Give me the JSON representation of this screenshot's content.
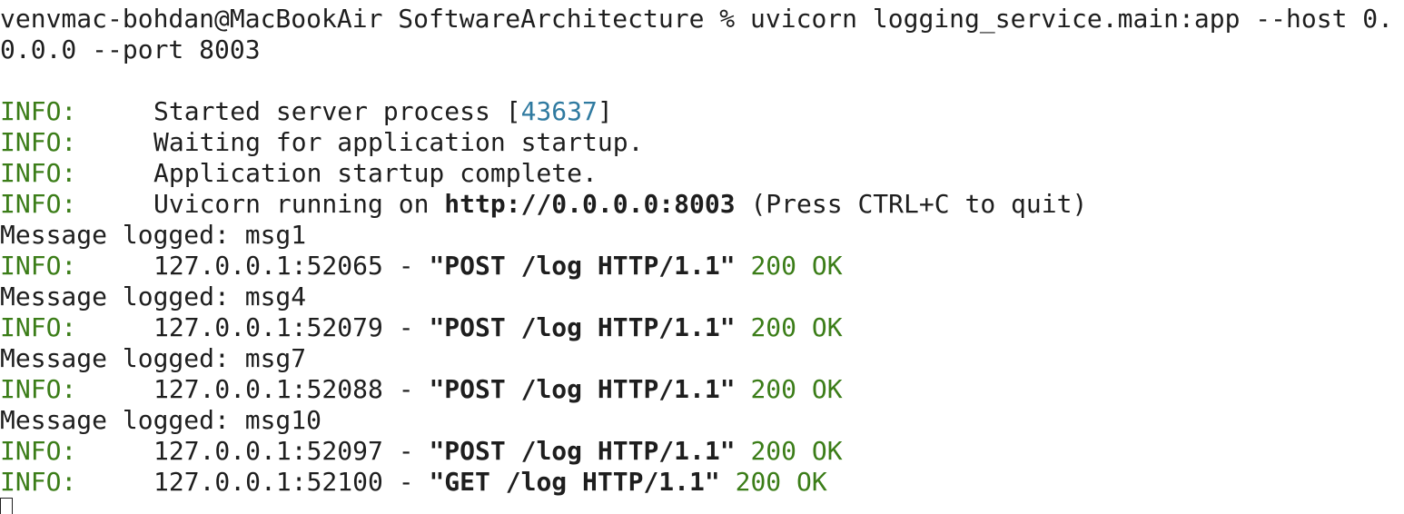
{
  "terminal": {
    "prompt_line_1": "venvmac-bohdan@MacBookAir SoftwareArchitecture % uvicorn logging_service.main:app --host 0.",
    "prompt_line_2": "0.0.0 --port 8003",
    "startup": {
      "line1": {
        "level": "INFO:",
        "pre": "Started server process [",
        "pid": "43637",
        "post": "]"
      },
      "line2": {
        "level": "INFO:",
        "text": "Waiting for application startup."
      },
      "line3": {
        "level": "INFO:",
        "text": "Application startup complete."
      },
      "line4": {
        "level": "INFO:",
        "pre": "Uvicorn running on ",
        "url": "http://0.0.0.0:8003",
        "post": " (Press CTRL+C to quit)"
      }
    },
    "log_entries": [
      {
        "message": "Message logged: msg1",
        "level": "INFO:",
        "addr": "127.0.0.1:52065 - ",
        "request": "\"POST /log HTTP/1.1\"",
        "status": "200 OK"
      },
      {
        "message": "Message logged: msg4",
        "level": "INFO:",
        "addr": "127.0.0.1:52079 - ",
        "request": "\"POST /log HTTP/1.1\"",
        "status": "200 OK"
      },
      {
        "message": "Message logged: msg7",
        "level": "INFO:",
        "addr": "127.0.0.1:52088 - ",
        "request": "\"POST /log HTTP/1.1\"",
        "status": "200 OK"
      },
      {
        "message": "Message logged: msg10",
        "level": "INFO:",
        "addr": "127.0.0.1:52097 - ",
        "request": "\"POST /log HTTP/1.1\"",
        "status": "200 OK"
      }
    ],
    "final_entry": {
      "level": "INFO:",
      "addr": "127.0.0.1:52100 - ",
      "request": "\"GET /log HTTP/1.1\"",
      "status": "200 OK"
    }
  }
}
